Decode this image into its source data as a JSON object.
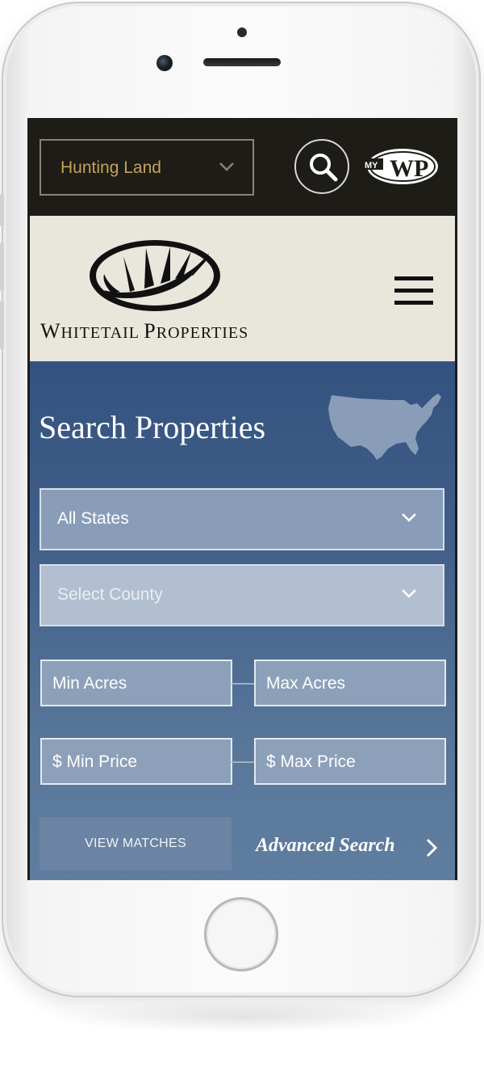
{
  "topbar": {
    "category_select": {
      "value": "Hunting Land",
      "text_color": "#c5a257"
    },
    "search_icon": "magnifier-icon",
    "mywp_logo": {
      "prefix": "MY",
      "text": "WP"
    }
  },
  "header": {
    "brand_text": {
      "initial1": "W",
      "rest1": "HITETAIL ",
      "initial2": "P",
      "rest2": "ROPERTIES"
    },
    "logo_icon": "antler-oval-logo",
    "menu_icon": "hamburger-menu-icon",
    "background": "#e9e7dc"
  },
  "search": {
    "title": "Search Properties",
    "map_icon": "usa-map-icon",
    "state_select": "All States",
    "county_select": "Select County",
    "min_acres": "Min Acres",
    "max_acres": "Max Acres",
    "min_price": "$ Min Price",
    "max_price": "$ Max Price",
    "view_matches": "VIEW MATCHES",
    "advanced_search": "Advanced Search",
    "panel_color": "#34527f"
  }
}
